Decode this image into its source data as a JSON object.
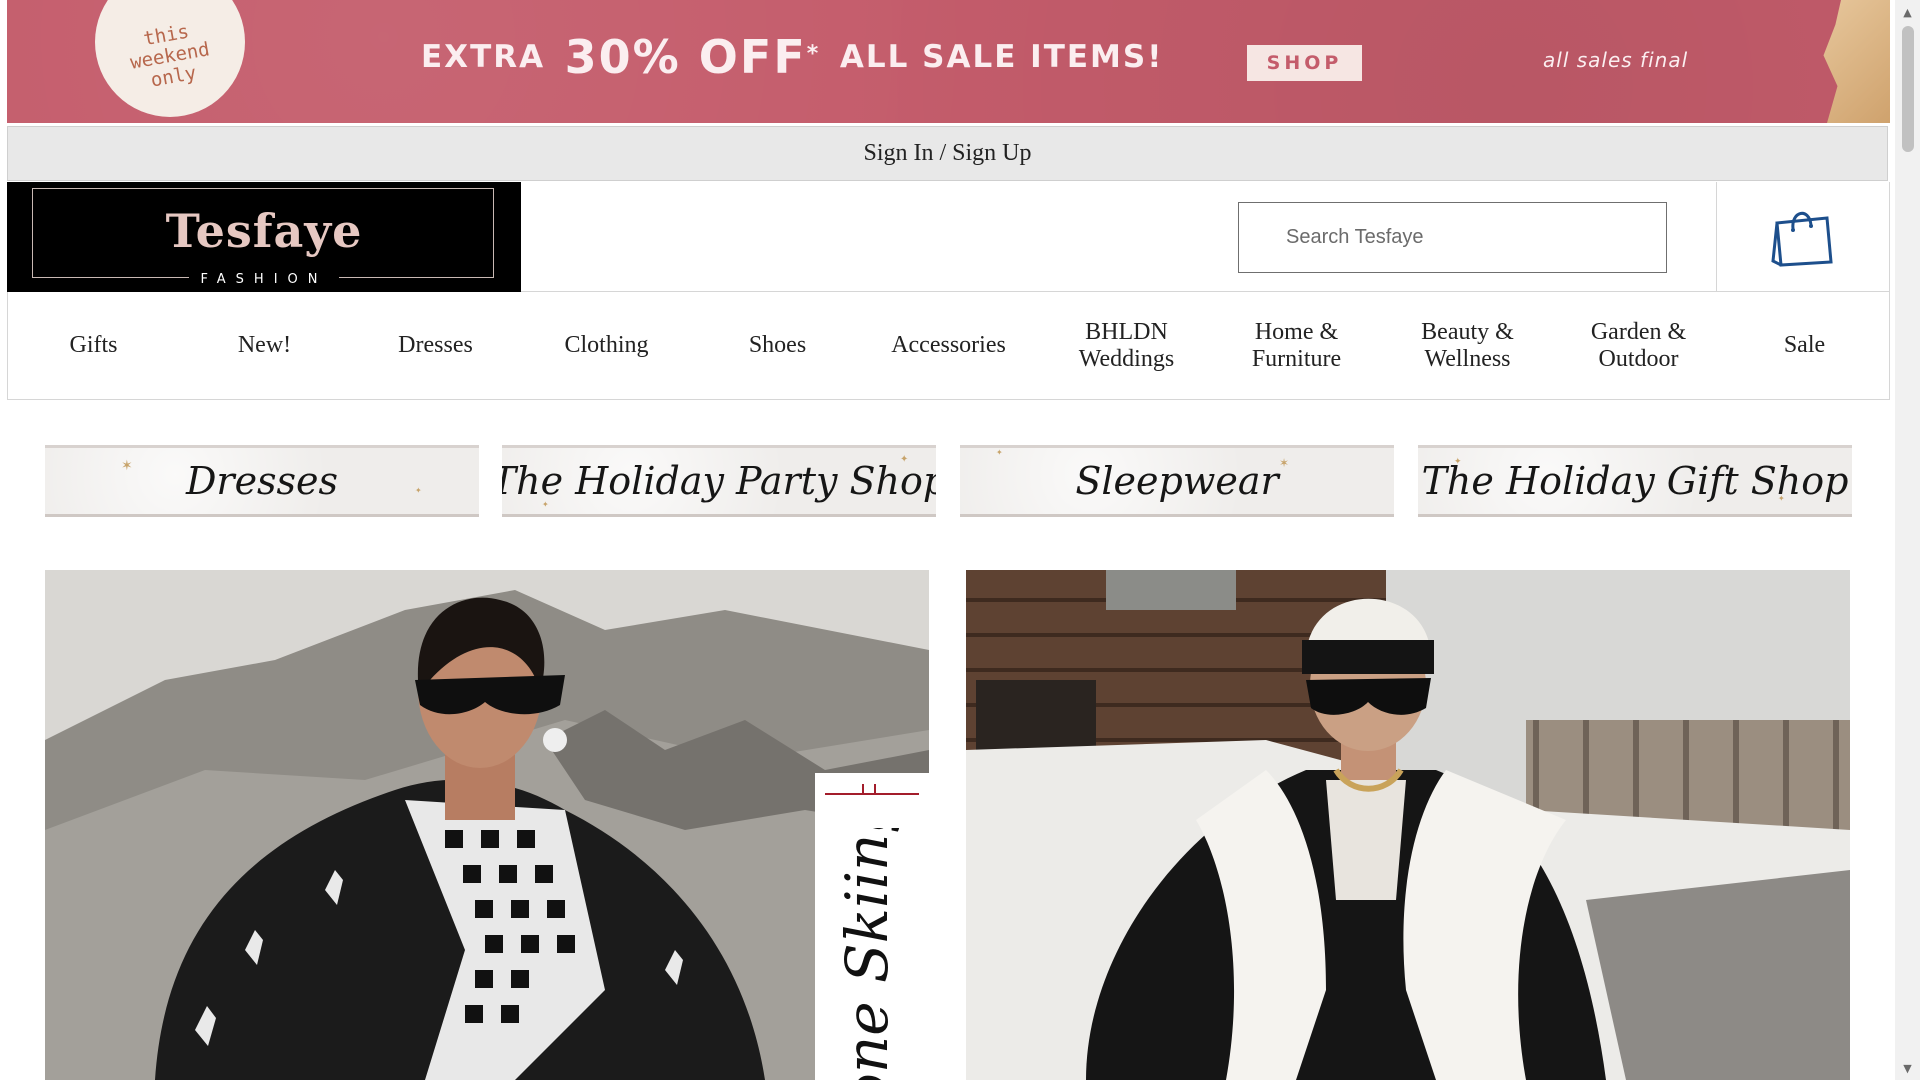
{
  "promo": {
    "badge_text": "this weekend only",
    "headline_prefix": "EXTRA",
    "headline_discount": "30% OFF",
    "headline_asterisk": "*",
    "headline_suffix": "ALL SALE ITEMS!",
    "shop_label": "SHOP",
    "disclaimer": "all sales final",
    "background_color": "#c45c6b"
  },
  "account": {
    "sign_in": "Sign In",
    "separator": "/",
    "sign_up": "Sign Up"
  },
  "header": {
    "brand": "Tesfaye",
    "brand_sub": "FASHION",
    "search_placeholder": "Search Tesfaye",
    "cart_icon": "shopping-bag-icon",
    "cart_color": "#1d4f8c"
  },
  "nav": {
    "items": [
      {
        "label": "Gifts"
      },
      {
        "label": "New!"
      },
      {
        "label": "Dresses"
      },
      {
        "label": "Clothing"
      },
      {
        "label": "Shoes"
      },
      {
        "label": "Accessories"
      },
      {
        "label": "BHLDN Weddings"
      },
      {
        "label": "Home & Furniture"
      },
      {
        "label": "Beauty & Wellness"
      },
      {
        "label": "Garden & Outdoor"
      },
      {
        "label": "Sale"
      }
    ]
  },
  "tiles": [
    {
      "label": "Dresses"
    },
    {
      "label": "The Holiday Party Shop"
    },
    {
      "label": "Sleepwear"
    },
    {
      "label": "The Holiday Gift Shop"
    }
  ],
  "heroes": {
    "left_ribbon_text": "one Skiing",
    "left_image": "woman-in-ski-jacket-and-houndstooth-scarf-on-mountain",
    "right_image": "woman-in-shearling-jacket-and-beanie-at-ski-lodge"
  }
}
